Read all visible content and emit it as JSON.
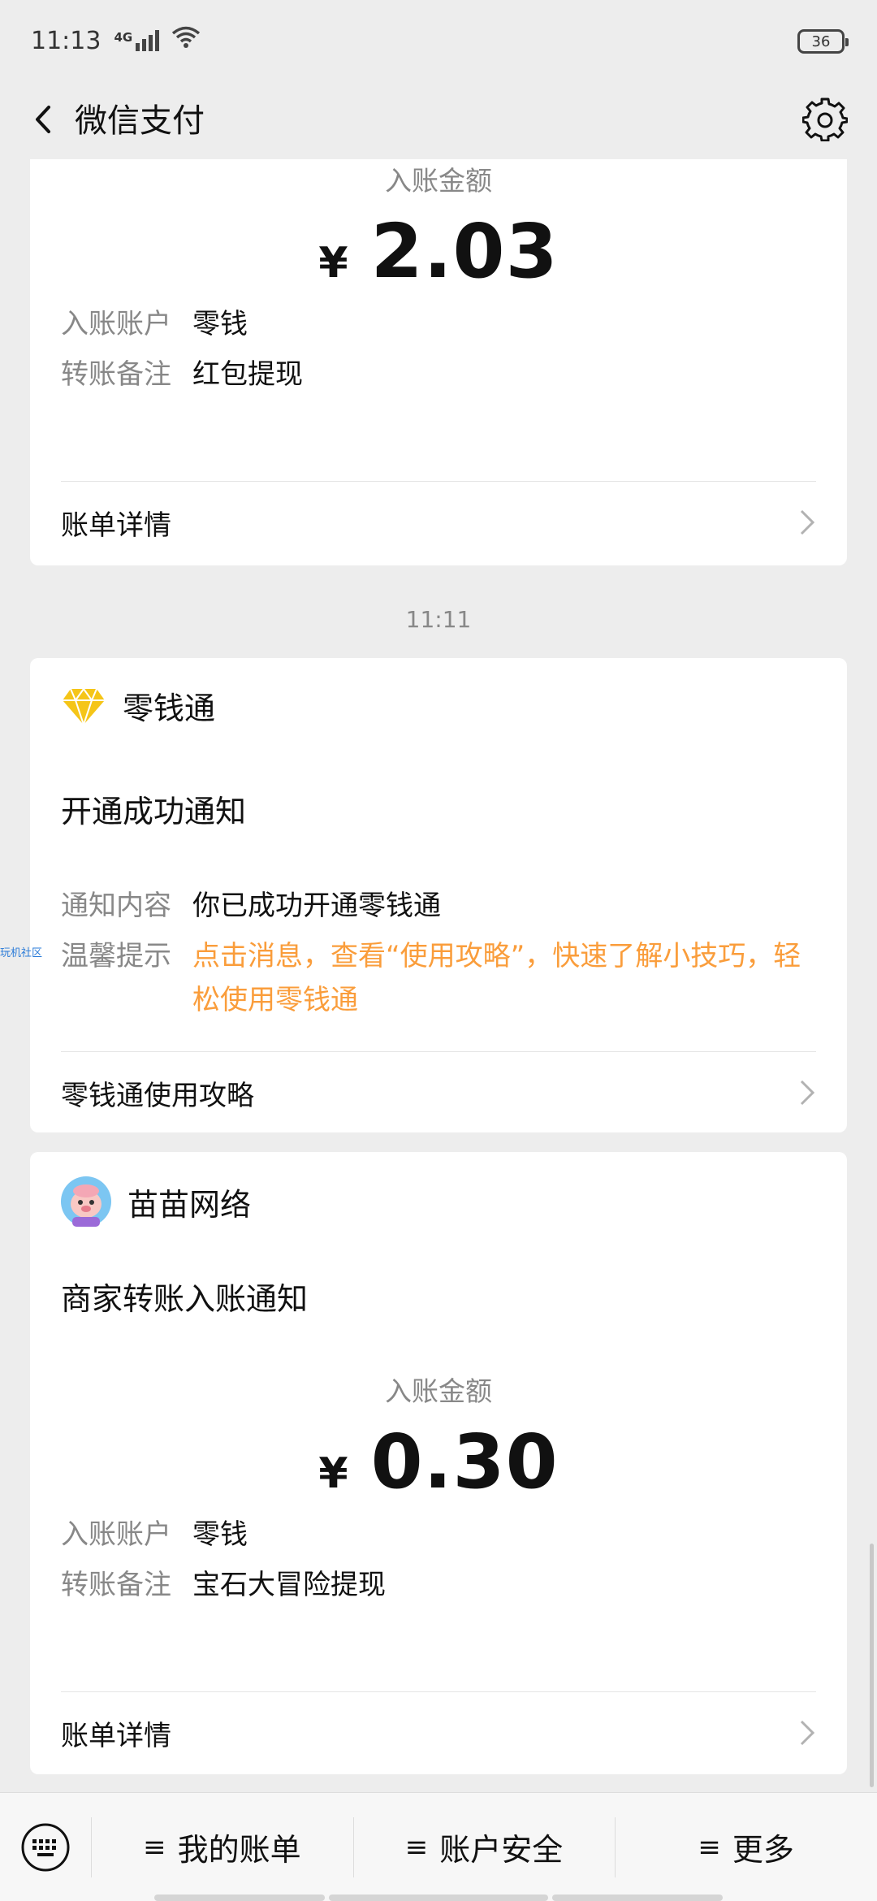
{
  "status_bar": {
    "time": "11:13",
    "network": "4G",
    "battery": "36"
  },
  "nav": {
    "title": "微信支付"
  },
  "card1": {
    "amount_label": "入账金额",
    "currency": "¥",
    "amount": "2.03",
    "rows": [
      {
        "k": "入账账户",
        "v": "零钱"
      },
      {
        "k": "转账备注",
        "v": "红包提现"
      }
    ],
    "link": "账单详情"
  },
  "timestamp": "11:11",
  "card2": {
    "app_name": "零钱通",
    "title": "开通成功通知",
    "rows": [
      {
        "k": "通知内容",
        "v": "你已成功开通零钱通"
      },
      {
        "k": "温馨提示",
        "v": "点击消息，查看“使用攻略”，快速了解小技巧，轻松使用零钱通"
      }
    ],
    "link": "零钱通使用攻略"
  },
  "card3": {
    "app_name": "苗苗网络",
    "title": "商家转账入账通知",
    "amount_label": "入账金额",
    "currency": "¥",
    "amount": "0.30",
    "rows": [
      {
        "k": "入账账户",
        "v": "零钱"
      },
      {
        "k": "转账备注",
        "v": "宝石大冒险提现"
      }
    ],
    "link": "账单详情"
  },
  "side_tag": "玩机社区",
  "bottom_menu": [
    "我的账单",
    "账户安全",
    "更多"
  ],
  "colors": {
    "accent_orange": "#fa9d3b",
    "diamond": "#f5c518"
  }
}
